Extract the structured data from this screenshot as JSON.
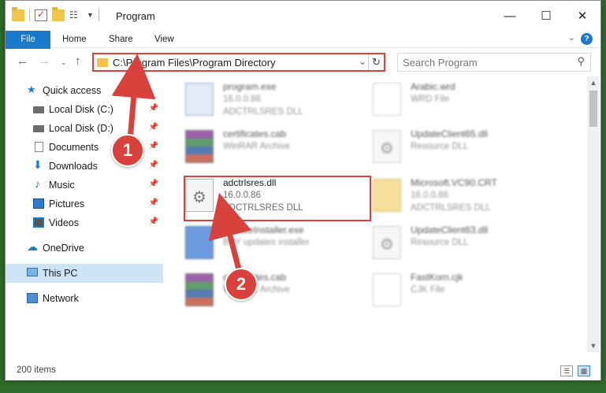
{
  "window": {
    "title": "Program",
    "controls": {
      "minimize": "—",
      "maximize": "☐",
      "close": "✕"
    }
  },
  "ribbon": {
    "tabs": [
      "File",
      "Home",
      "Share",
      "View"
    ],
    "help": "?"
  },
  "address": {
    "path": "C:\\Program Files\\Program Directory"
  },
  "search": {
    "placeholder": "Search Program"
  },
  "sidebar": {
    "items": [
      {
        "label": "Quick access",
        "icon": "star-icon"
      },
      {
        "label": "Local Disk (C:)",
        "icon": "drive-icon",
        "pinned": true
      },
      {
        "label": "Local Disk (D:)",
        "icon": "drive-icon",
        "pinned": true
      },
      {
        "label": "Documents",
        "icon": "documents-icon",
        "pinned": true
      },
      {
        "label": "Downloads",
        "icon": "downloads-icon",
        "pinned": true
      },
      {
        "label": "Music",
        "icon": "music-icon",
        "pinned": true
      },
      {
        "label": "Pictures",
        "icon": "pictures-icon",
        "pinned": true
      },
      {
        "label": "Videos",
        "icon": "videos-icon",
        "pinned": true
      },
      {
        "label": "OneDrive",
        "icon": "onedrive-icon"
      },
      {
        "label": "This PC",
        "icon": "pc-icon",
        "selected": true
      },
      {
        "label": "Network",
        "icon": "network-icon"
      }
    ]
  },
  "files": [
    {
      "name": "program.exe",
      "line1": "16.0.0.86",
      "line2": "ADCTRLSRES DLL"
    },
    {
      "name": "Arabic.wrd",
      "line1": "WRD File",
      "line2": ""
    },
    {
      "name": "certificates.cab",
      "line1": "WinRAR Archive",
      "line2": ""
    },
    {
      "name": "UpdateClient65.dll",
      "line1": "Resource DLL",
      "line2": ""
    },
    {
      "name": "adctrlsres.dll",
      "line1": "16.0.0.86",
      "line2": "ADCTRLSRES DLL"
    },
    {
      "name": "Microsoft.VC90.CRT",
      "line1": "16.0.0.86",
      "line2": "ADCTRLSRES DLL"
    },
    {
      "name": "UpdateInstaller.exe",
      "line1": "BBY updates installer",
      "line2": ""
    },
    {
      "name": "UpdateClient63.dll",
      "line1": "Resource DLL",
      "line2": ""
    },
    {
      "name": "certificates.cab",
      "line1": "WinRAR Archive",
      "line2": ""
    },
    {
      "name": "FastKorn.cjk",
      "line1": "CJK File",
      "line2": ""
    }
  ],
  "status": {
    "count": "200 items"
  },
  "annotations": {
    "step1": "1",
    "step2": "2"
  },
  "colors": {
    "accent": "#1979ca",
    "highlight": "#d8413c",
    "selected": "#cce4f7"
  }
}
